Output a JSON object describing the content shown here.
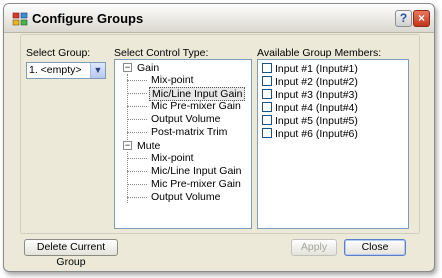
{
  "window": {
    "title": "Configure Groups",
    "help_glyph": "?",
    "close_glyph": "×"
  },
  "select_group": {
    "label": "Select Group:",
    "value": "1. <empty>",
    "arrow": "▼"
  },
  "control_type": {
    "label": "Select Control Type:",
    "tree": [
      {
        "label": "Gain",
        "expander": "−",
        "children": [
          "Mix-point",
          "Mic/Line Input Gain",
          "Mic Pre-mixer Gain",
          "Output Volume",
          "Post-matrix Trim"
        ]
      },
      {
        "label": "Mute",
        "expander": "−",
        "children": [
          "Mix-point",
          "Mic/Line Input Gain",
          "Mic Pre-mixer Gain",
          "Output Volume"
        ]
      }
    ],
    "selected": "Gain / Mic/Line Input Gain"
  },
  "members": {
    "label": "Available Group Members:",
    "items": [
      "Input #1 (Input#1)",
      "Input #2 (Input#2)",
      "Input #3 (Input#3)",
      "Input #4 (Input#4)",
      "Input #5 (Input#5)",
      "Input #6 (Input#6)"
    ]
  },
  "buttons": {
    "delete": "Delete Current Group",
    "apply": "Apply",
    "close": "Close"
  },
  "colors": {
    "dialog_bg": "#ece9d8",
    "list_border": "#7f9db9",
    "close_red": "#c2351c"
  }
}
